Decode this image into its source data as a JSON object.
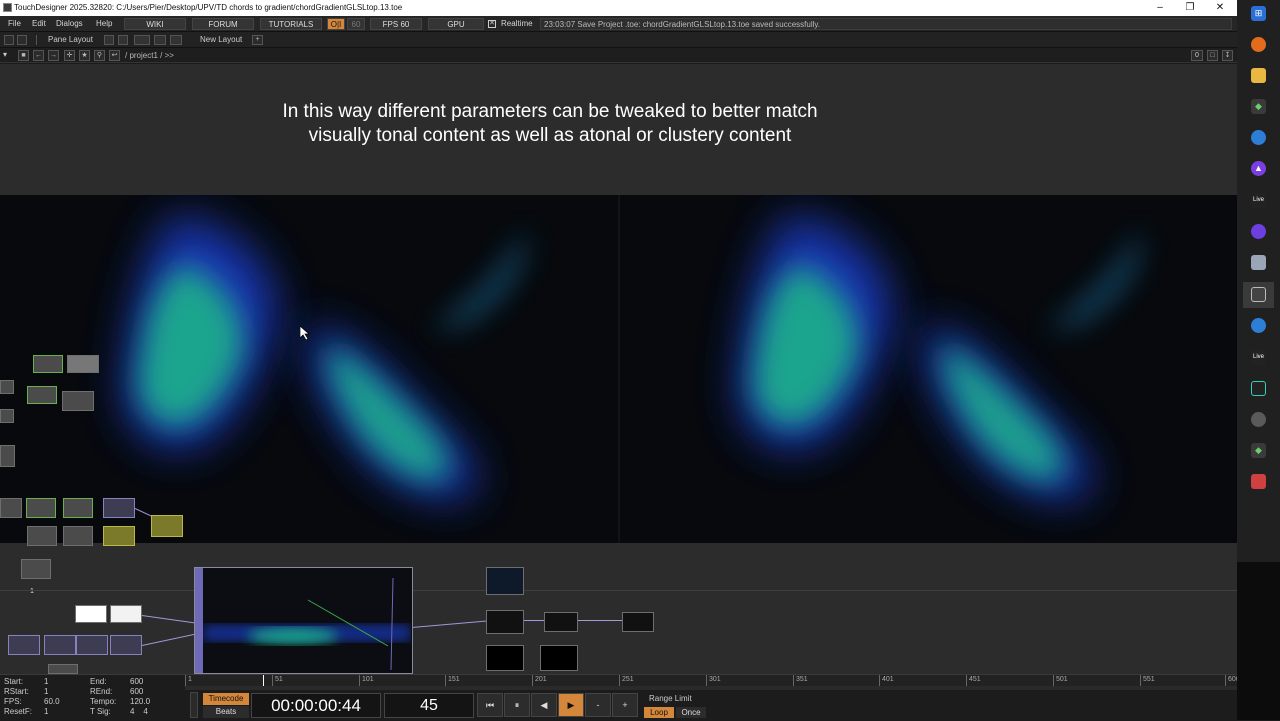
{
  "window": {
    "title": "TouchDesigner 2025.32820: C:/Users/Pier/Desktop/UPV/TD chords to gradient/chordGradientGLSLtop.13.toe"
  },
  "menu": {
    "file": "File",
    "edit": "Edit",
    "dialogs": "Dialogs",
    "help": "Help",
    "wiki": "WIKI",
    "forum": "FORUM",
    "tutorials": "TUTORIALS",
    "oi": "O|I",
    "sixty": "60",
    "fps": "FPS  60",
    "gpu": "GPU",
    "realtime": "Realtime",
    "status": "23:03:07 Save Project .toe: chordGradientGLSLtop.13.toe saved successfully."
  },
  "panebar": {
    "pane_layout": "Pane Layout",
    "new_layout": "New Layout",
    "plus": "+"
  },
  "pathbar": {
    "path": "/ project1 / >>",
    "index": "0"
  },
  "network": {
    "caption_line1": "In this way different parameters can be tweaked to better match",
    "caption_line2": "visually tonal content as well as atonal or clustery content",
    "node_label_1": "1"
  },
  "timeline": {
    "start_label": "Start:",
    "start_val": "1",
    "end_label": "End:",
    "end_val": "600",
    "rstart_label": "RStart:",
    "rstart_val": "1",
    "rend_label": "REnd:",
    "rend_val": "600",
    "fps_label": "FPS:",
    "fps_val": "60.0",
    "tempo_label": "Tempo:",
    "tempo_val": "120.0",
    "resetf_label": "ResetF:",
    "resetf_val": "1",
    "tsig_label": "T Sig:",
    "tsig_val": "4    4",
    "timecode_label": "Timecode",
    "beats_label": "Beats",
    "timecode": "00:00:00:44",
    "frame": "45",
    "range_limit": "Range Limit",
    "loop": "Loop",
    "once": "Once",
    "ruler_ticks": [
      "1",
      "51",
      "101",
      "151",
      "201",
      "251",
      "301",
      "351",
      "401",
      "451",
      "501",
      "551",
      "600"
    ],
    "btn_rewind": "⏮",
    "btn_pause": "⏸",
    "btn_back": "◀",
    "btn_play": "▶",
    "btn_minus": "-",
    "btn_plus": "+"
  },
  "colors": {
    "accent": "#d4873a",
    "wire": "#9c9ad8",
    "gradient_teal": "#1fb08a",
    "gradient_blue": "#1b3fd1"
  }
}
